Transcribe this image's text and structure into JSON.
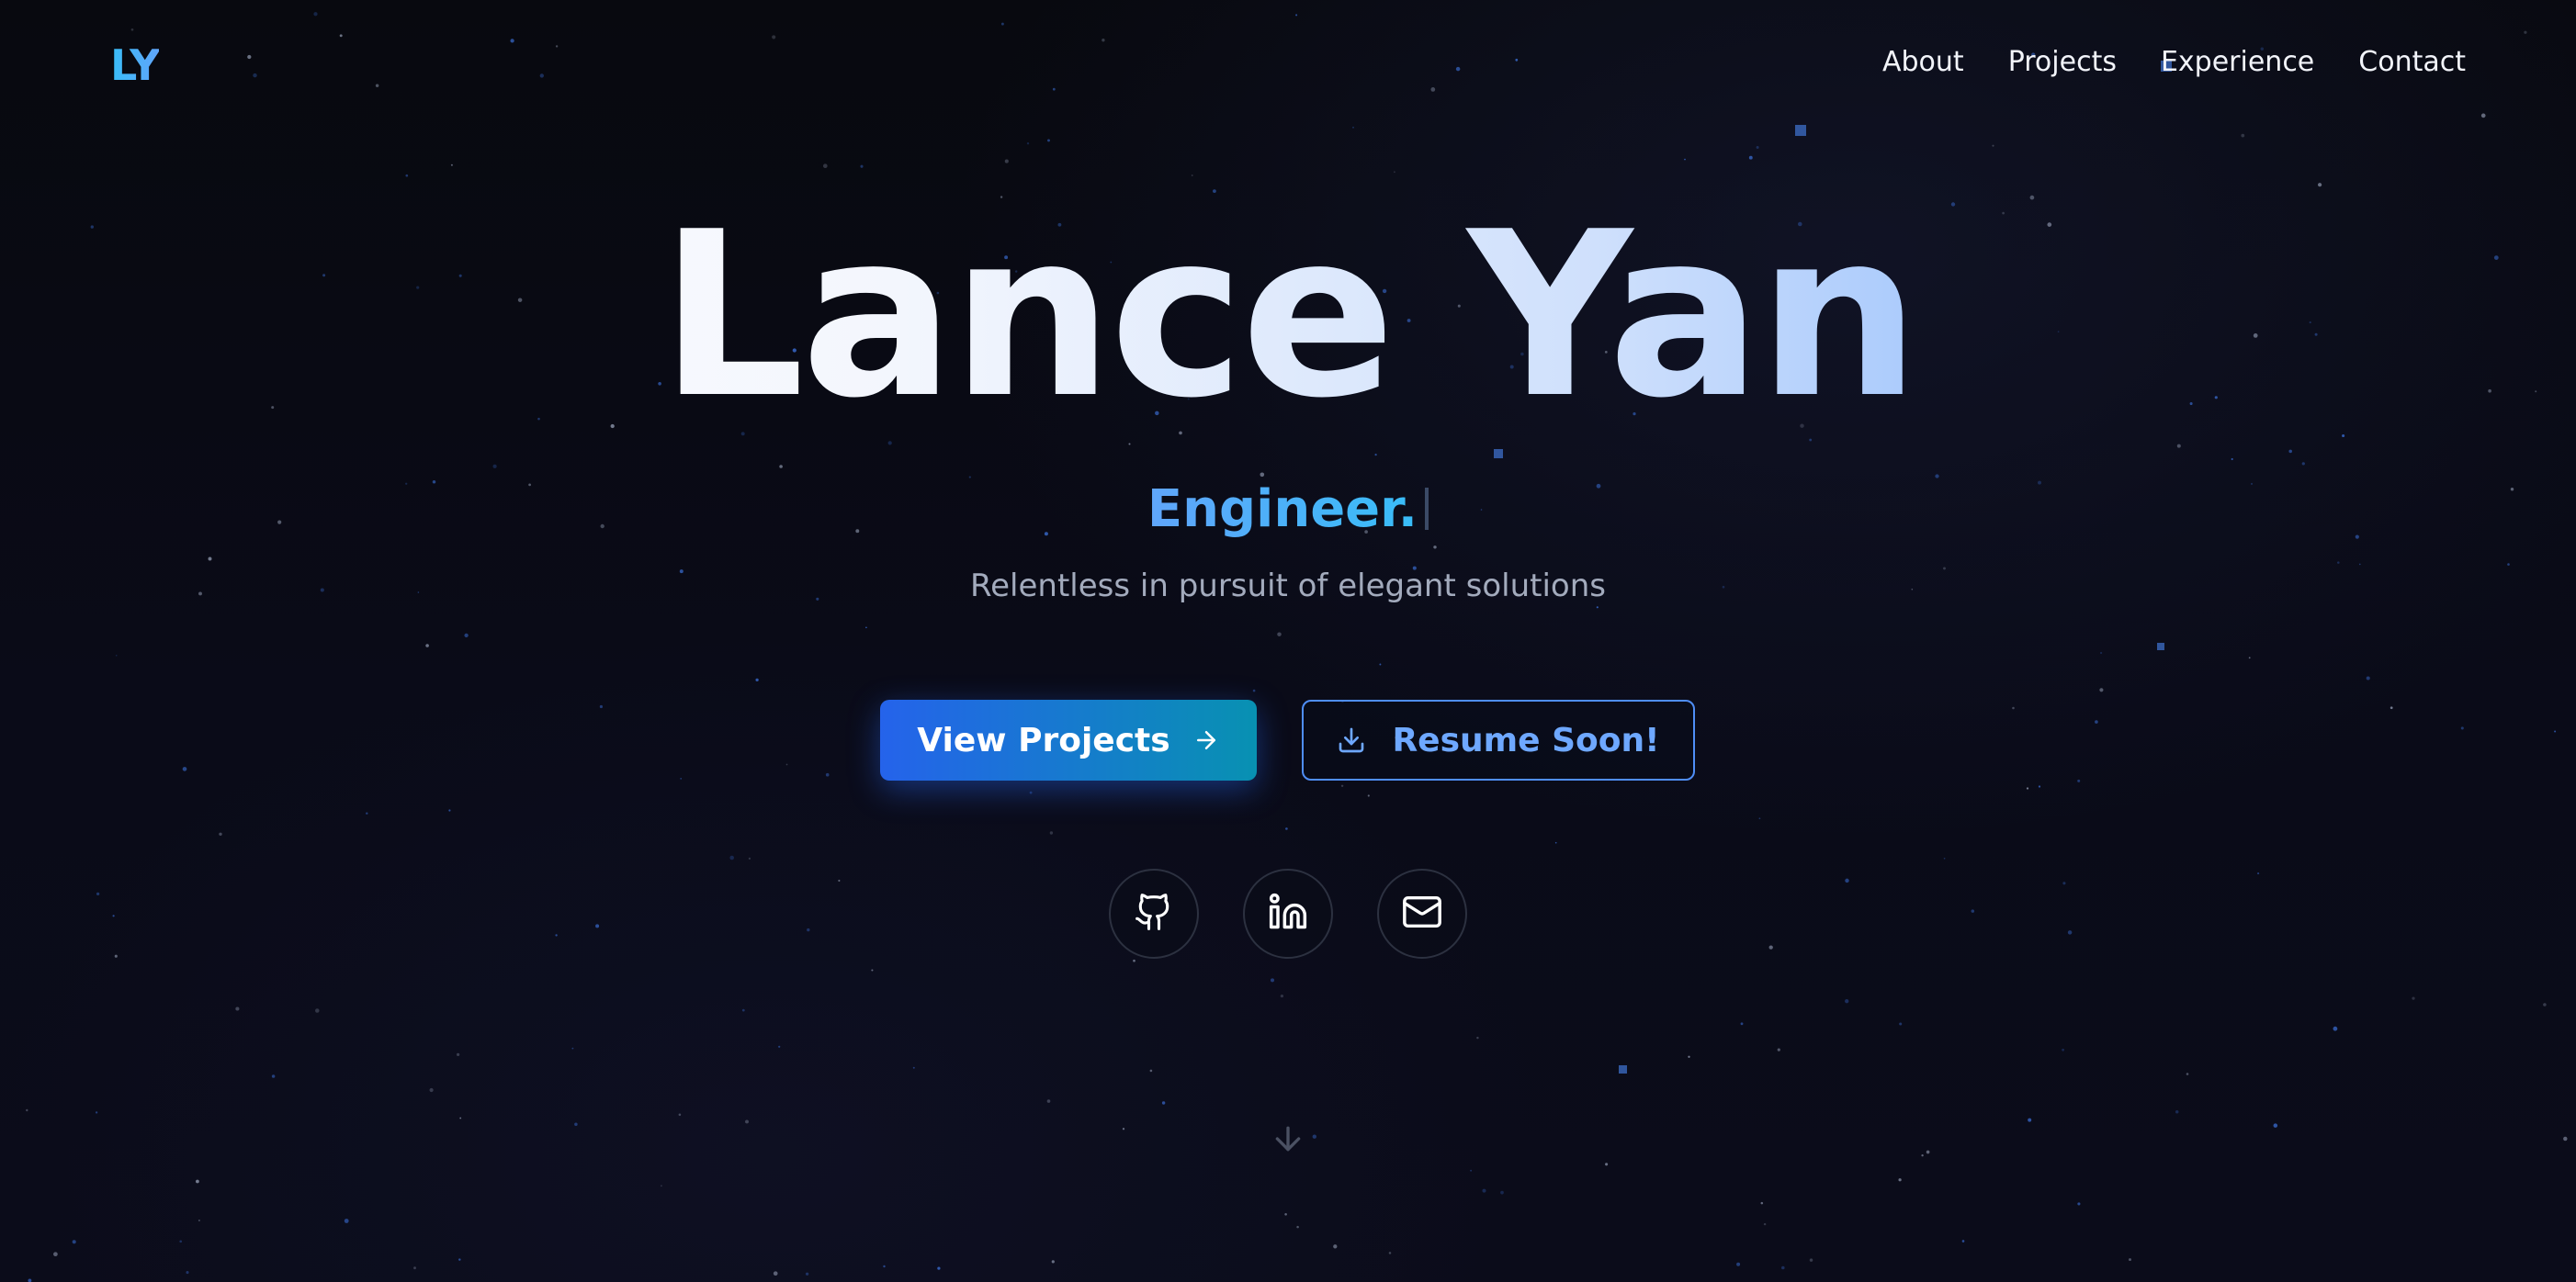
{
  "header": {
    "logo": "LY",
    "nav": [
      {
        "label": "About"
      },
      {
        "label": "Projects"
      },
      {
        "label": "Experience"
      },
      {
        "label": "Contact"
      }
    ]
  },
  "hero": {
    "name": "Lance Yan",
    "role": "Engineer.",
    "tagline": "Relentless in pursuit of elegant solutions"
  },
  "actions": {
    "primary_label": "View Projects",
    "primary_icon": "arrow-right-icon",
    "secondary_label": "Resume Soon!",
    "secondary_icon": "download-icon"
  },
  "socials": [
    {
      "icon": "github-icon"
    },
    {
      "icon": "linkedin-icon"
    },
    {
      "icon": "mail-icon"
    }
  ],
  "scroll_icon": "arrow-down-icon",
  "colors": {
    "background": "#08090f",
    "accent_blue": "#2563eb",
    "accent_cyan": "#0891b2",
    "logo": "#38bdf8",
    "secondary_button": "#6ea8ff",
    "tagline": "#a3abbd"
  }
}
